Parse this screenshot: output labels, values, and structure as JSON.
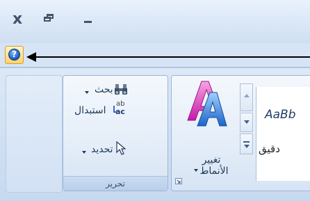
{
  "window": {
    "close_glyph": "x",
    "controls": [
      "close",
      "restore",
      "minimize"
    ]
  },
  "help": {
    "glyph": "?"
  },
  "ribbon": {
    "edit_group": {
      "label": "تحرير",
      "find_label": "بحث",
      "replace_label": "استبدال",
      "replace_icon_text": "ab",
      "replace_icon_text2": "ac",
      "select_label": "تحديد"
    },
    "styles_group": {
      "change_styles_line1": "تغيير",
      "change_styles_line2": "الأنماط",
      "preview_text": "AaBb",
      "style_name": "دقيق"
    }
  },
  "colors": {
    "accent": "#1d5fc8",
    "ribbon_text": "#1e395b",
    "help_bg": "#ffd36b"
  }
}
